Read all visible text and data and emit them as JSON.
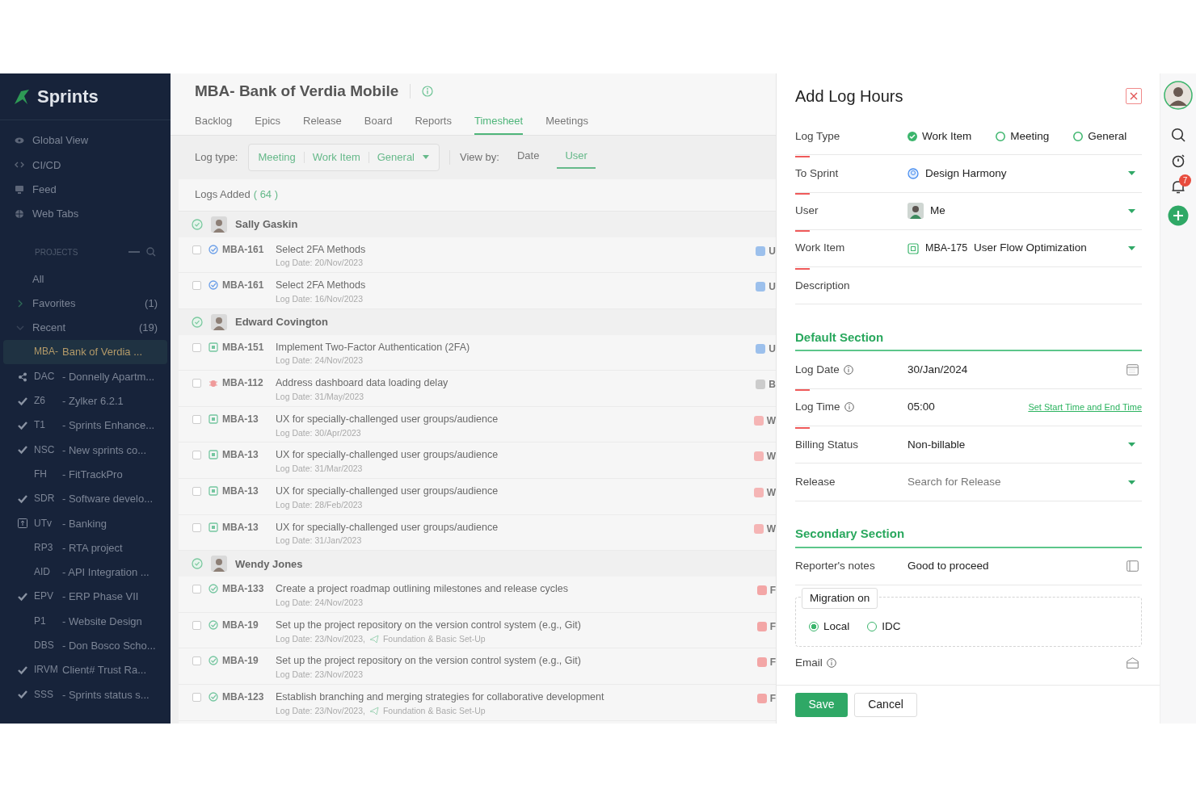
{
  "sidebar": {
    "brand": "Sprints",
    "nav": [
      {
        "label": "Global View",
        "kind": "eye"
      },
      {
        "label": "CI/CD",
        "kind": "code"
      },
      {
        "label": "Feed",
        "kind": "feed"
      },
      {
        "label": "Web Tabs",
        "kind": "globe"
      }
    ],
    "projects_heading": "PROJECTS",
    "groups": [
      {
        "label": "All"
      },
      {
        "label": "Favorites",
        "count": "(1)",
        "expanded": false
      },
      {
        "label": "Recent",
        "count": "(19)",
        "expanded": true
      }
    ],
    "projects": [
      {
        "code": "MBA-",
        "name": "Bank of Verdia ...",
        "kind": "none",
        "selected": true
      },
      {
        "code": "DAC",
        "name": "- Donnelly Apartm...",
        "kind": "share",
        "selected": false
      },
      {
        "code": "Z6",
        "name": "- Zylker 6.2.1",
        "kind": "check",
        "selected": false
      },
      {
        "code": "T1",
        "name": "- Sprints Enhance...",
        "kind": "check",
        "selected": false
      },
      {
        "code": "NSC",
        "name": "- New sprints co...",
        "kind": "check",
        "selected": false
      },
      {
        "code": "FH",
        "name": "- FitTrackPro",
        "kind": "none",
        "selected": false
      },
      {
        "code": "SDR",
        "name": "- Software develo...",
        "kind": "check",
        "selected": false
      },
      {
        "code": "UTv",
        "name": "- Banking",
        "kind": "layout",
        "selected": false
      },
      {
        "code": "RP3",
        "name": "- RTA project",
        "kind": "none",
        "selected": false
      },
      {
        "code": "AID",
        "name": "- API Integration ...",
        "kind": "none",
        "selected": false
      },
      {
        "code": "EPV",
        "name": "- ERP Phase VII",
        "kind": "check",
        "selected": false
      },
      {
        "code": "P1",
        "name": "- Website Design",
        "kind": "none",
        "selected": false
      },
      {
        "code": "DBS",
        "name": "- Don Bosco Scho...",
        "kind": "none",
        "selected": false
      },
      {
        "code": "IRVM",
        "name": "Client# Trust Ra...",
        "kind": "check",
        "selected": false
      },
      {
        "code": "SSS",
        "name": "- Sprints status s...",
        "kind": "check",
        "selected": false
      }
    ]
  },
  "project": {
    "title": "MBA- Bank of Verdia Mobile",
    "tabs": [
      {
        "label": "Backlog",
        "selected": false
      },
      {
        "label": "Epics",
        "selected": false
      },
      {
        "label": "Release",
        "selected": false
      },
      {
        "label": "Board",
        "selected": false
      },
      {
        "label": "Reports",
        "selected": false
      },
      {
        "label": "Timesheet",
        "selected": true
      },
      {
        "label": "Meetings",
        "selected": false
      }
    ]
  },
  "filters": {
    "log_type_label": "Log type:",
    "log_types": [
      "Meeting",
      "Work Item",
      "General"
    ],
    "view_by_label": "View by:",
    "views": [
      {
        "label": "Date",
        "selected": false
      },
      {
        "label": "User",
        "selected": true
      }
    ]
  },
  "logs": {
    "title": "Logs Added",
    "count": "( 64 )",
    "groups": [
      {
        "user": "Sally Gaskin",
        "items": [
          {
            "id": "MBA-161",
            "kind": "sprint",
            "title": "Select 2FA Methods",
            "date": "Log Date: 20/Nov/2023",
            "checked": false,
            "tag": "U",
            "color": "#9cc0ec"
          },
          {
            "id": "MBA-161",
            "kind": "sprint",
            "title": "Select 2FA Methods",
            "date": "Log Date: 16/Nov/2023",
            "checked": false,
            "tag": "U",
            "color": "#9cc0ec"
          }
        ]
      },
      {
        "user": "Edward Covington",
        "items": [
          {
            "id": "MBA-151",
            "kind": "doc",
            "title": "Implement Two-Factor Authentication (2FA)",
            "date": "Log Date: 24/Nov/2023",
            "checked": false,
            "tag": "U",
            "color": "#9cc0ec"
          },
          {
            "id": "MBA-112",
            "kind": "bug",
            "title": "Address dashboard data loading delay",
            "date": "Log Date: 31/May/2023",
            "checked": false,
            "tag": "B",
            "color": "#cccccc"
          },
          {
            "id": "MBA-13",
            "kind": "doc",
            "title": "UX for specially-challenged user groups/audience",
            "date": "Log Date: 30/Apr/2023",
            "checked": false,
            "tag": "W",
            "color": "#f5b5b5"
          },
          {
            "id": "MBA-13",
            "kind": "doc",
            "title": "UX for specially-challenged user groups/audience",
            "date": "Log Date: 31/Mar/2023",
            "checked": false,
            "tag": "W",
            "color": "#f5b5b5"
          },
          {
            "id": "MBA-13",
            "kind": "doc",
            "title": "UX for specially-challenged user groups/audience",
            "date": "Log Date: 28/Feb/2023",
            "checked": false,
            "tag": "W",
            "color": "#f5b5b5"
          },
          {
            "id": "MBA-13",
            "kind": "doc",
            "title": "UX for specially-challenged user groups/audience",
            "date": "Log Date: 31/Jan/2023",
            "checked": false,
            "tag": "W",
            "color": "#f5b5b5"
          }
        ]
      },
      {
        "user": "Wendy Jones",
        "items": [
          {
            "id": "MBA-133",
            "kind": "task",
            "title": "Create a project roadmap outlining milestones and release cycles",
            "date": "Log Date: 24/Nov/2023",
            "checked": false,
            "tag": "F",
            "color": "#f3a6a6"
          },
          {
            "id": "MBA-19",
            "kind": "task",
            "title": "Set up the project repository on the version control system (e.g., Git)",
            "date": "Log Date: 23/Nov/2023,",
            "release": "Foundation & Basic Set-Up",
            "checked": false,
            "tag": "F",
            "color": "#f3a6a6"
          },
          {
            "id": "MBA-19",
            "kind": "task",
            "title": "Set up the project repository on the version control system (e.g., Git)",
            "date": "Log Date: 23/Nov/2023",
            "checked": false,
            "tag": "F",
            "color": "#f3a6a6"
          },
          {
            "id": "MBA-123",
            "kind": "task",
            "title": "Establish branching and merging strategies for collaborative development",
            "date": "Log Date: 23/Nov/2023,",
            "release": "Foundation & Basic Set-Up",
            "checked": false,
            "tag": "F",
            "color": "#f3a6a6"
          }
        ]
      }
    ]
  },
  "drawer": {
    "title": "Add Log Hours",
    "fields": [
      {
        "kind": "radios",
        "label": "Log Type",
        "required": true,
        "options": [
          {
            "label": "Work Item",
            "selected": true
          },
          {
            "label": "Meeting",
            "selected": false
          },
          {
            "label": "General",
            "selected": false
          }
        ]
      },
      {
        "kind": "sprint",
        "label": "To Sprint",
        "required": true,
        "value": "Design Harmony"
      },
      {
        "kind": "user",
        "label": "User",
        "required": true,
        "value": "Me"
      },
      {
        "kind": "workitem",
        "label": "Work Item",
        "required": true,
        "id": "MBA-175",
        "value": "User Flow Optimization"
      },
      {
        "kind": "text",
        "label": "Description",
        "required": false
      },
      {
        "kind": "section",
        "label": "Default Section"
      },
      {
        "kind": "date",
        "label": "Log Date",
        "info": true,
        "required": true,
        "value": "30/Jan/2024"
      },
      {
        "kind": "time",
        "label": "Log Time",
        "info": true,
        "required": true,
        "value": "05:00",
        "link": "Set Start Time and End Time"
      },
      {
        "kind": "select",
        "label": "Billing Status",
        "required": false,
        "value": "Non-billable"
      },
      {
        "kind": "select",
        "label": "Release",
        "required": false,
        "placeholder": "Search for Release"
      },
      {
        "kind": "section",
        "label": "Secondary Section"
      },
      {
        "kind": "note",
        "label": "Reporter's notes",
        "required": false,
        "value": "Good to proceed"
      },
      {
        "kind": "fieldset",
        "label": "Migration on",
        "options": [
          {
            "label": "Local",
            "selected": true
          },
          {
            "label": "IDC",
            "selected": false
          }
        ]
      },
      {
        "kind": "email",
        "label": "Email",
        "info": true,
        "required": false
      }
    ],
    "buttons": [
      {
        "label": "Save",
        "kind": "primary"
      },
      {
        "label": "Cancel",
        "kind": "secondary"
      }
    ]
  },
  "rail": {
    "notifications": "7"
  }
}
